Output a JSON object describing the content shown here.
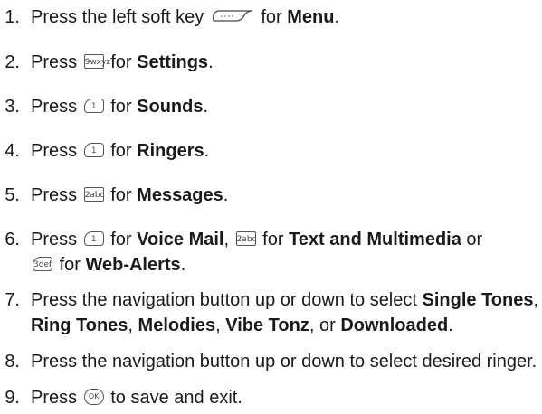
{
  "steps": [
    {
      "num": "1.",
      "pre": "Press the left soft key",
      "mid": "for",
      "bold": "Menu",
      "post": "."
    },
    {
      "num": "2.",
      "pre": "Press",
      "key": "9wxyz",
      "mid": "for",
      "bold": "Settings",
      "post": "."
    },
    {
      "num": "3.",
      "pre": "Press",
      "key": "1",
      "mid": "for",
      "bold": "Sounds",
      "post": "."
    },
    {
      "num": "4.",
      "pre": "Press",
      "key": "1",
      "mid": "for",
      "bold": "Ringers",
      "post": "."
    },
    {
      "num": "5.",
      "pre": "Press",
      "key": "2abc",
      "mid": "for",
      "bold": "Messages",
      "post": "."
    },
    {
      "num": "6.",
      "pre": "Press",
      "key1": "1",
      "mid1": "for",
      "bold1": "Voice Mail",
      "sep1": ",",
      "key2": "2abc",
      "mid2": "for",
      "bold2": "Text and Multimedia",
      "sep2": "or",
      "key3": "3def",
      "mid3": "for",
      "bold3": "Web-Alerts",
      "post": "."
    },
    {
      "num": "7.",
      "pre": "Press the navigation button up or down to select",
      "bold1": "Single Tones",
      "sep1": ",",
      "bold2": "Ring Tones",
      "sep2": ",",
      "bold3": "Melodies",
      "sep3": ",",
      "bold4": "Vibe Tonz",
      "sep4": ", or",
      "bold5": "Downloaded",
      "post": "."
    },
    {
      "num": "8.",
      "pre": "Press the navigation button up or down to select desired ringer."
    },
    {
      "num": "9.",
      "pre": "Press",
      "key": "OK",
      "post": "to save and exit."
    }
  ]
}
